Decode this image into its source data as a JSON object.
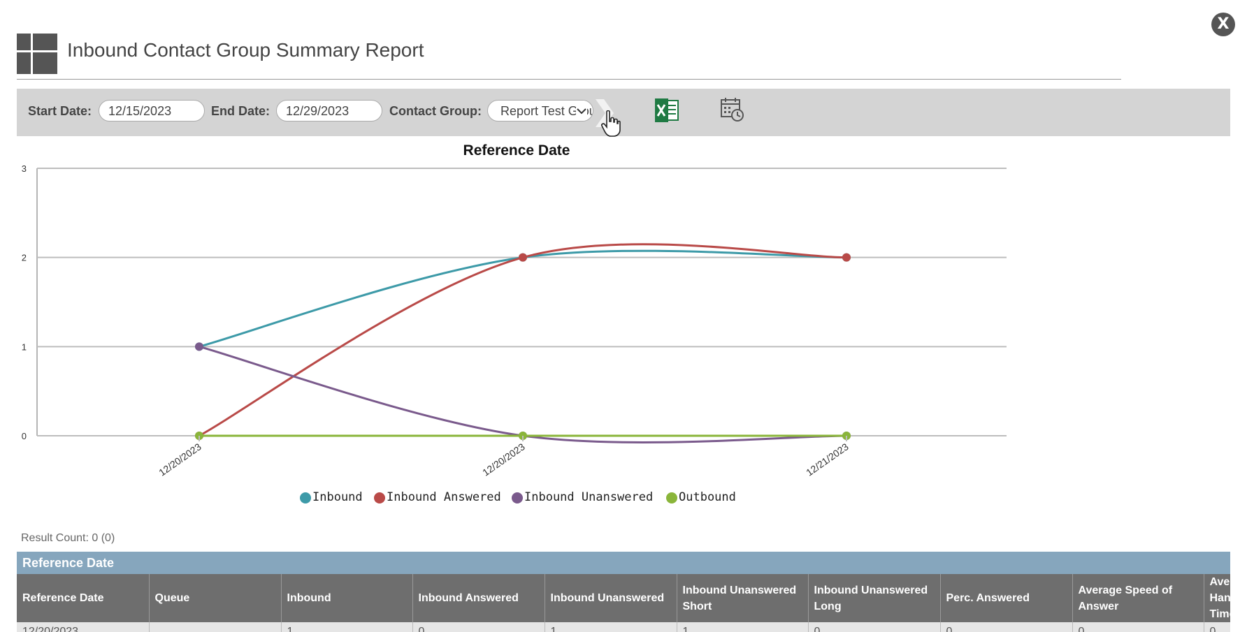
{
  "window": {
    "close_label": "X"
  },
  "header": {
    "title": "Inbound Contact Group Summary Report"
  },
  "toolbar": {
    "start_date_label": "Start Date:",
    "start_date_value": "12/15/2023",
    "end_date_label": "End Date:",
    "end_date_value": "12/29/2023",
    "contact_group_label": "Contact Group:",
    "contact_group_value": "Report Test Group",
    "icons": [
      "run-arrow-icon",
      "excel-export-icon",
      "schedule-icon"
    ]
  },
  "chart_data": {
    "type": "line",
    "title": "Reference Date",
    "categories": [
      "12/20/2023",
      "12/20/2023",
      "12/21/2023"
    ],
    "ylim": [
      0,
      3
    ],
    "yticks": [
      0,
      1,
      2,
      3
    ],
    "grid": true,
    "legend_position": "bottom",
    "series": [
      {
        "name": "Inbound",
        "color": "#3d9aa8",
        "values": [
          1,
          2,
          2
        ]
      },
      {
        "name": "Inbound Answered",
        "color": "#b94a48",
        "values": [
          0,
          2,
          2
        ]
      },
      {
        "name": "Inbound Unanswered",
        "color": "#7a5a8c",
        "values": [
          1,
          0,
          0
        ]
      },
      {
        "name": "Outbound",
        "color": "#8ab53a",
        "values": [
          0,
          0,
          0
        ]
      }
    ]
  },
  "results": {
    "count_text": "Result Count: 0 (0)",
    "group_header": "Reference Date",
    "columns": [
      "Reference Date",
      "Queue",
      "Inbound",
      "Inbound Answered",
      "Inbound Unanswered",
      "Inbound Unanswered Short",
      "Inbound Unanswered Long",
      "Perc. Answered",
      "Average Speed of Answer",
      "Average Handle Time"
    ],
    "rows": [
      [
        "12/20/2023",
        "",
        "1",
        "0",
        "1",
        "1",
        "0",
        "0",
        "0",
        "0"
      ]
    ]
  },
  "colors": {
    "toolbar_bg": "#d4d4d4",
    "group_header_bg": "#86a6bd",
    "column_header_bg": "#6e6e6e",
    "row_bg": "#e6e6e6"
  }
}
